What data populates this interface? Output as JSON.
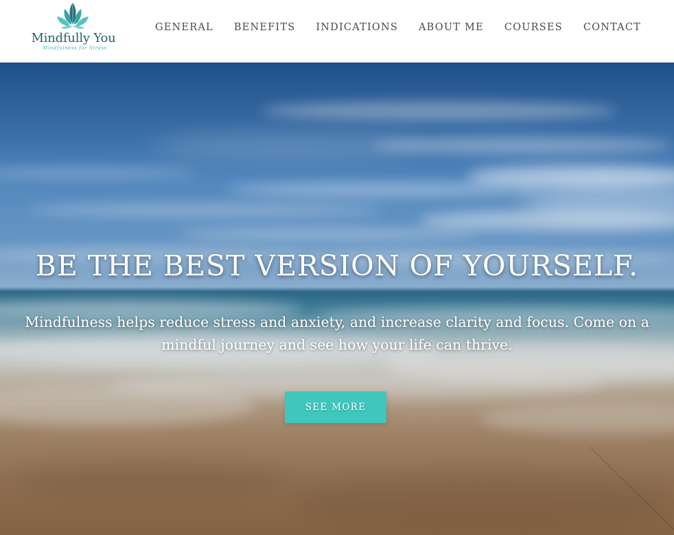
{
  "header": {
    "logo": {
      "name": "Mindfully You",
      "tagline": "Mindfulness for Stress",
      "icon": "lotus-leaves-icon"
    },
    "nav": [
      {
        "label": "GENERAL"
      },
      {
        "label": "BENEFITS"
      },
      {
        "label": "INDICATIONS"
      },
      {
        "label": "ABOUT ME"
      },
      {
        "label": "COURSES"
      },
      {
        "label": "CONTACT"
      }
    ]
  },
  "hero": {
    "title": "BE THE BEST VERSION OF YOURSELF.",
    "subtitle": "Mindfulness helps reduce stress and anxiety, and increase clarity and focus. Come on a mindful journey and see how your life can thrive.",
    "cta_label": "SEE MORE",
    "background": "beach-seascape-image"
  },
  "colors": {
    "brand_dark": "#26606f",
    "brand_teal": "#3fb6b1",
    "cta": "#3fc6bd",
    "nav_text": "#4a4a4a"
  }
}
